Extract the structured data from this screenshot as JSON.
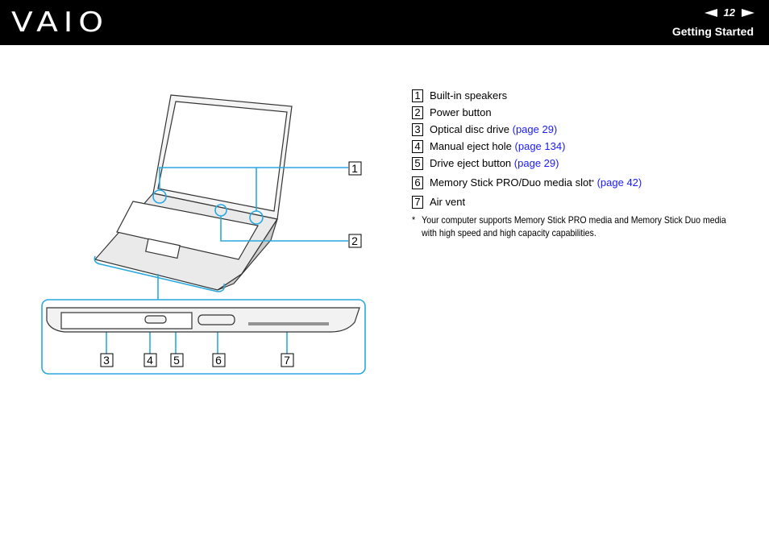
{
  "header": {
    "brand": "VAIO",
    "page_number": "12",
    "section": "Getting Started",
    "prev_icon": "left-triangle-icon",
    "next_icon": "right-triangle-icon"
  },
  "figure": {
    "callouts": [
      "1",
      "2",
      "3",
      "4",
      "5",
      "6",
      "7"
    ],
    "callout_color": "#29a8e0"
  },
  "items": [
    {
      "num": "1",
      "text": "Built-in speakers",
      "link": ""
    },
    {
      "num": "2",
      "text": "Power button",
      "link": ""
    },
    {
      "num": "3",
      "text": "Optical disc drive ",
      "link": "(page 29)"
    },
    {
      "num": "4",
      "text": "Manual eject hole ",
      "link": "(page 134)"
    },
    {
      "num": "5",
      "text": "Drive eject button ",
      "link": "(page 29)"
    },
    {
      "num": "6",
      "text": "Memory Stick PRO/Duo media slot",
      "sup": "*",
      "link": "(page 42)"
    },
    {
      "num": "7",
      "text": "Air vent",
      "link": ""
    }
  ],
  "footnote": {
    "mark": "*",
    "text": "Your computer supports Memory Stick PRO media and Memory Stick Duo media with high speed and high capacity capabilities."
  },
  "link_color": "#1a1aff"
}
